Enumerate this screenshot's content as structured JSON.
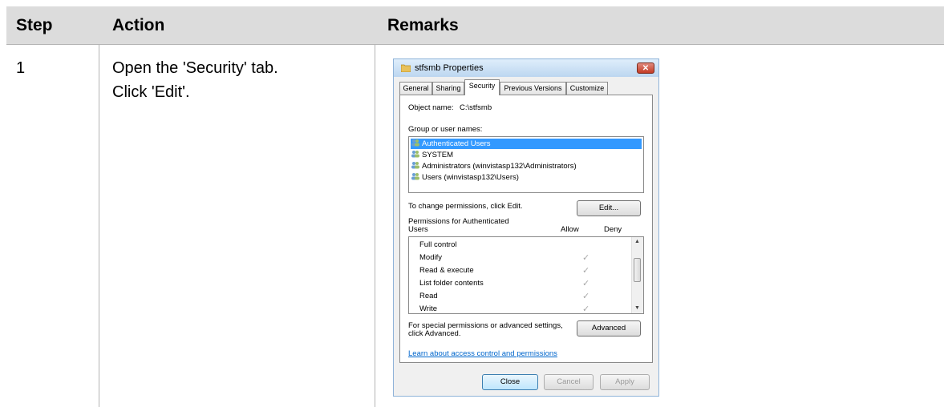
{
  "table": {
    "headers": [
      "Step",
      "Action",
      "Remarks"
    ],
    "rows": [
      {
        "step": "1",
        "action_lines": [
          "Open the 'Security' tab.",
          "Click 'Edit'."
        ]
      }
    ]
  },
  "dialog": {
    "title": "stfsmb Properties",
    "close_glyph": "✕",
    "tabs": [
      "General",
      "Sharing",
      "Security",
      "Previous Versions",
      "Customize"
    ],
    "active_tab": "Security",
    "object_name_label": "Object name:",
    "object_name_value": "C:\\stfsmb",
    "group_label": "Group or user names:",
    "users": [
      "Authenticated Users",
      "SYSTEM",
      "Administrators (winvistasp132\\Administrators)",
      "Users (winvistasp132\\Users)"
    ],
    "change_perm_text": "To change permissions, click Edit.",
    "edit_button": "Edit...",
    "permissions_for_line1": "Permissions for Authenticated",
    "permissions_for_line2": "Users",
    "allow_header": "Allow",
    "deny_header": "Deny",
    "permissions": [
      {
        "name": "Full control",
        "allow": false
      },
      {
        "name": "Modify",
        "allow": true
      },
      {
        "name": "Read & execute",
        "allow": true
      },
      {
        "name": "List folder contents",
        "allow": true
      },
      {
        "name": "Read",
        "allow": true
      },
      {
        "name": "Write",
        "allow": true
      }
    ],
    "check_glyph": "✓",
    "special_text_line1": "For special permissions or advanced settings,",
    "special_text_line2": "click Advanced.",
    "advanced_button": "Advanced",
    "learn_link": "Learn about access control and permissions",
    "close_button": "Close",
    "cancel_button": "Cancel",
    "apply_button": "Apply",
    "colors": {
      "selection": "#3399ff",
      "link": "#0066cc",
      "header_bg": "#dcdcdc"
    }
  }
}
